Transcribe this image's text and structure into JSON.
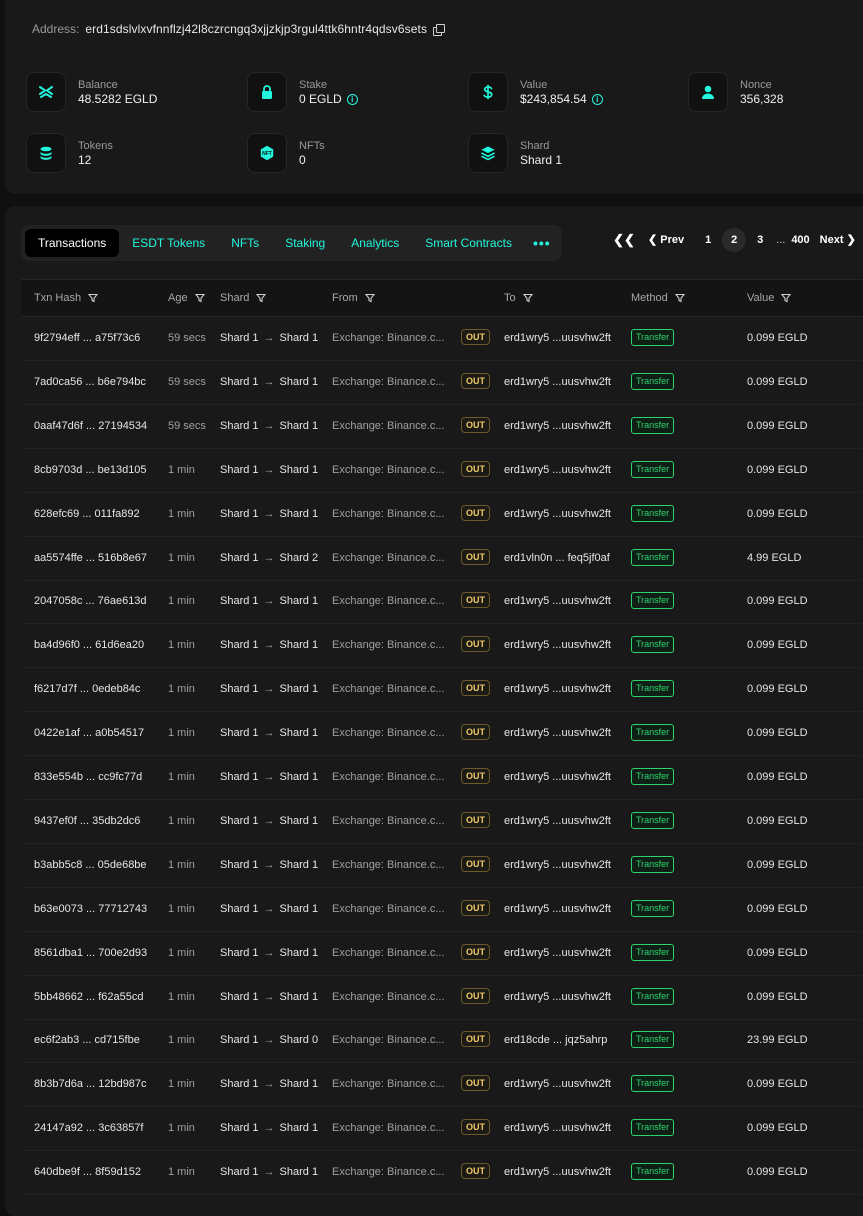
{
  "account": {
    "address_label": "Address:",
    "address": "erd1sdslvlxvfnnflzj42l8czrcngq3xjjzkjp3rgul4ttk6hntr4qdsv6sets"
  },
  "stats": [
    {
      "label": "Balance",
      "value": "48.5282 EGLD",
      "icon": "egld-logo-icon",
      "info": false
    },
    {
      "label": "Stake",
      "value": "0 EGLD",
      "icon": "lock-icon",
      "info": true
    },
    {
      "label": "Value",
      "value": "$243,854.54",
      "icon": "dollar-icon",
      "info": true
    },
    {
      "label": "Nonce",
      "value": "356,328",
      "icon": "user-icon",
      "info": false
    },
    {
      "label": "Tokens",
      "value": "12",
      "icon": "coins-icon",
      "info": false
    },
    {
      "label": "NFTs",
      "value": "0",
      "icon": "nft-icon",
      "info": false
    },
    {
      "label": "Shard",
      "value": "Shard 1",
      "icon": "layers-icon",
      "info": false
    }
  ],
  "tabs": [
    "Transactions",
    "ESDT Tokens",
    "NFTs",
    "Staking",
    "Analytics",
    "Smart Contracts"
  ],
  "active_tab": "Transactions",
  "pagination": {
    "prev": "Prev",
    "next": "Next",
    "pages": [
      "1",
      "2",
      "3"
    ],
    "current": "2",
    "ellipsis": "...",
    "last": "400"
  },
  "columns": [
    "Txn Hash",
    "Age",
    "Shard",
    "From",
    "To",
    "Method",
    "Value"
  ],
  "accent_color": "#23f7dd",
  "transactions": [
    {
      "hash": "9f2794eff ... a75f73c6",
      "age": "59 secs",
      "from_shard": "Shard 1",
      "to_shard": "Shard 1",
      "from": "Exchange: Binance.c...",
      "dir": "OUT",
      "to": "erd1wry5 ...uusvhw2ft",
      "method": "Transfer",
      "value": "0.099 EGLD"
    },
    {
      "hash": "7ad0ca56 ... b6e794bc",
      "age": "59 secs",
      "from_shard": "Shard 1",
      "to_shard": "Shard 1",
      "from": "Exchange: Binance.c...",
      "dir": "OUT",
      "to": "erd1wry5 ...uusvhw2ft",
      "method": "Transfer",
      "value": "0.099 EGLD"
    },
    {
      "hash": "0aaf47d6f ... 27194534",
      "age": "59 secs",
      "from_shard": "Shard 1",
      "to_shard": "Shard 1",
      "from": "Exchange: Binance.c...",
      "dir": "OUT",
      "to": "erd1wry5 ...uusvhw2ft",
      "method": "Transfer",
      "value": "0.099 EGLD"
    },
    {
      "hash": "8cb9703d ... be13d105",
      "age": "1 min",
      "from_shard": "Shard 1",
      "to_shard": "Shard 1",
      "from": "Exchange: Binance.c...",
      "dir": "OUT",
      "to": "erd1wry5 ...uusvhw2ft",
      "method": "Transfer",
      "value": "0.099 EGLD"
    },
    {
      "hash": "628efc69 ... 011fa892",
      "age": "1 min",
      "from_shard": "Shard 1",
      "to_shard": "Shard 1",
      "from": "Exchange: Binance.c...",
      "dir": "OUT",
      "to": "erd1wry5 ...uusvhw2ft",
      "method": "Transfer",
      "value": "0.099 EGLD"
    },
    {
      "hash": "aa5574ffe ... 516b8e67",
      "age": "1 min",
      "from_shard": "Shard 1",
      "to_shard": "Shard 2",
      "from": "Exchange: Binance.c...",
      "dir": "OUT",
      "to": "erd1vln0n ... feq5jf0af",
      "method": "Transfer",
      "value": "4.99 EGLD"
    },
    {
      "hash": "2047058c ... 76ae613d",
      "age": "1 min",
      "from_shard": "Shard 1",
      "to_shard": "Shard 1",
      "from": "Exchange: Binance.c...",
      "dir": "OUT",
      "to": "erd1wry5 ...uusvhw2ft",
      "method": "Transfer",
      "value": "0.099 EGLD"
    },
    {
      "hash": "ba4d96f0 ... 61d6ea20",
      "age": "1 min",
      "from_shard": "Shard 1",
      "to_shard": "Shard 1",
      "from": "Exchange: Binance.c...",
      "dir": "OUT",
      "to": "erd1wry5 ...uusvhw2ft",
      "method": "Transfer",
      "value": "0.099 EGLD"
    },
    {
      "hash": "f6217d7f ... 0edeb84c",
      "age": "1 min",
      "from_shard": "Shard 1",
      "to_shard": "Shard 1",
      "from": "Exchange: Binance.c...",
      "dir": "OUT",
      "to": "erd1wry5 ...uusvhw2ft",
      "method": "Transfer",
      "value": "0.099 EGLD"
    },
    {
      "hash": "0422e1af ... a0b54517",
      "age": "1 min",
      "from_shard": "Shard 1",
      "to_shard": "Shard 1",
      "from": "Exchange: Binance.c...",
      "dir": "OUT",
      "to": "erd1wry5 ...uusvhw2ft",
      "method": "Transfer",
      "value": "0.099 EGLD"
    },
    {
      "hash": "833e554b ... cc9fc77d",
      "age": "1 min",
      "from_shard": "Shard 1",
      "to_shard": "Shard 1",
      "from": "Exchange: Binance.c...",
      "dir": "OUT",
      "to": "erd1wry5 ...uusvhw2ft",
      "method": "Transfer",
      "value": "0.099 EGLD"
    },
    {
      "hash": "9437ef0f ... 35db2dc6",
      "age": "1 min",
      "from_shard": "Shard 1",
      "to_shard": "Shard 1",
      "from": "Exchange: Binance.c...",
      "dir": "OUT",
      "to": "erd1wry5 ...uusvhw2ft",
      "method": "Transfer",
      "value": "0.099 EGLD"
    },
    {
      "hash": "b3abb5c8 ... 05de68be",
      "age": "1 min",
      "from_shard": "Shard 1",
      "to_shard": "Shard 1",
      "from": "Exchange: Binance.c...",
      "dir": "OUT",
      "to": "erd1wry5 ...uusvhw2ft",
      "method": "Transfer",
      "value": "0.099 EGLD"
    },
    {
      "hash": "b63e0073 ... 77712743",
      "age": "1 min",
      "from_shard": "Shard 1",
      "to_shard": "Shard 1",
      "from": "Exchange: Binance.c...",
      "dir": "OUT",
      "to": "erd1wry5 ...uusvhw2ft",
      "method": "Transfer",
      "value": "0.099 EGLD"
    },
    {
      "hash": "8561dba1 ... 700e2d93",
      "age": "1 min",
      "from_shard": "Shard 1",
      "to_shard": "Shard 1",
      "from": "Exchange: Binance.c...",
      "dir": "OUT",
      "to": "erd1wry5 ...uusvhw2ft",
      "method": "Transfer",
      "value": "0.099 EGLD"
    },
    {
      "hash": "5bb48662 ... f62a55cd",
      "age": "1 min",
      "from_shard": "Shard 1",
      "to_shard": "Shard 1",
      "from": "Exchange: Binance.c...",
      "dir": "OUT",
      "to": "erd1wry5 ...uusvhw2ft",
      "method": "Transfer",
      "value": "0.099 EGLD"
    },
    {
      "hash": "ec6f2ab3 ... cd715fbe",
      "age": "1 min",
      "from_shard": "Shard 1",
      "to_shard": "Shard 0",
      "from": "Exchange: Binance.c...",
      "dir": "OUT",
      "to": "erd18cde ... jqz5ahrp",
      "method": "Transfer",
      "value": "23.99 EGLD"
    },
    {
      "hash": "8b3b7d6a ... 12bd987c",
      "age": "1 min",
      "from_shard": "Shard 1",
      "to_shard": "Shard 1",
      "from": "Exchange: Binance.c...",
      "dir": "OUT",
      "to": "erd1wry5 ...uusvhw2ft",
      "method": "Transfer",
      "value": "0.099 EGLD"
    },
    {
      "hash": "24147a92 ... 3c63857f",
      "age": "1 min",
      "from_shard": "Shard 1",
      "to_shard": "Shard 1",
      "from": "Exchange: Binance.c...",
      "dir": "OUT",
      "to": "erd1wry5 ...uusvhw2ft",
      "method": "Transfer",
      "value": "0.099 EGLD"
    },
    {
      "hash": "640dbe9f ... 8f59d152",
      "age": "1 min",
      "from_shard": "Shard 1",
      "to_shard": "Shard 1",
      "from": "Exchange: Binance.c...",
      "dir": "OUT",
      "to": "erd1wry5 ...uusvhw2ft",
      "method": "Transfer",
      "value": "0.099 EGLD"
    }
  ]
}
